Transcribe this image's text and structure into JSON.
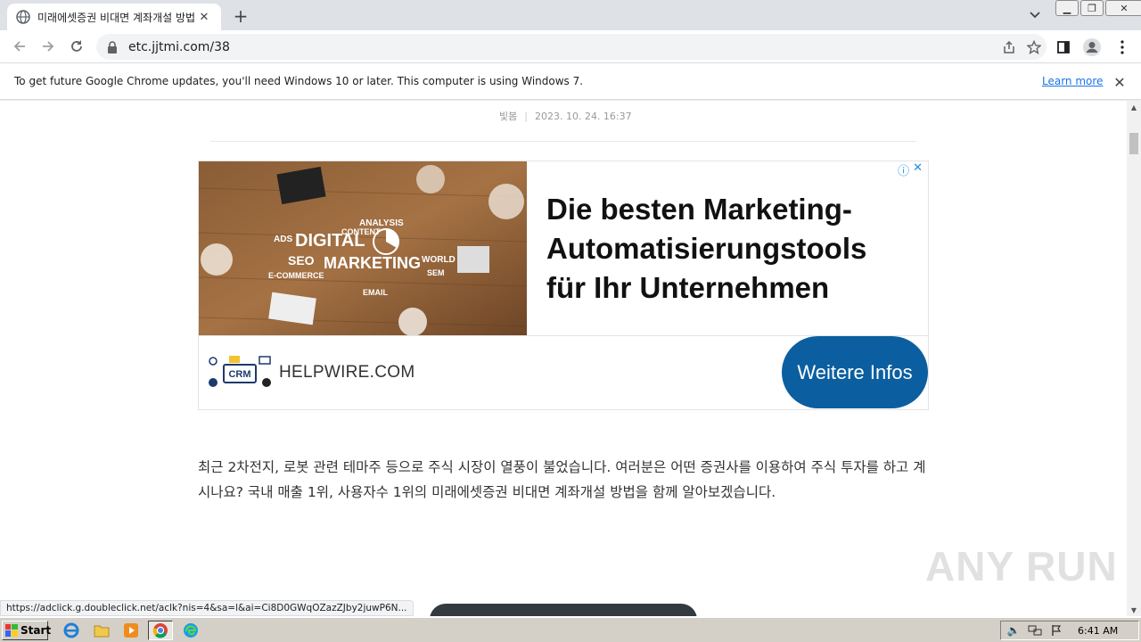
{
  "browser": {
    "tab": {
      "title": "미래에셋증권 비대면 계좌개설 방법",
      "close_glyph": "✕"
    },
    "new_tab_glyph": "+",
    "url": "etc.jjtmi.com/38"
  },
  "infobar": {
    "message": "To get future Google Chrome updates, you'll need Windows 10 or later. This computer is using Windows 7.",
    "link": "Learn more",
    "close_glyph": "✕"
  },
  "post": {
    "author": "빛봄",
    "date": "2023. 10. 24. 16:37"
  },
  "ad": {
    "headline": "Die besten Marketing-Automatisierungstools für Ihr Unternehmen",
    "brand": "HELPWIRE.COM",
    "cta": "Weitere Infos",
    "logo_text": "CRM",
    "image_words": [
      "DIGITAL",
      "MARKETING",
      "SEO",
      "CONTENT",
      "ANALYSIS",
      "E-COMMERCE",
      "EMAIL",
      "ADS",
      "SEM",
      "WORLD"
    ]
  },
  "article": {
    "paragraph": "최근 2차전지, 로봇 관련 테마주 등으로 주식 시장이 열풍이 불었습니다. 여러분은 어떤 증권사를 이용하여 주식 투자를 하고 계시나요? 국내 매출 1위, 사용자수 1위의 미래에셋증권 비대면 계좌개설 방법을 함께 알아보겠습니다."
  },
  "status_url": "https://adclick.g.doubleclick.net/aclk?nis=4&sa=l&ai=Ci8D0GWqOZazZJby2juwP6N...",
  "watermark": "ANY RUN",
  "taskbar": {
    "start": "Start",
    "clock": "6:41 AM"
  },
  "colors": {
    "cta": "#0b5fa0",
    "link": "#1a73e8",
    "taskbar": "#d4d0c8"
  }
}
